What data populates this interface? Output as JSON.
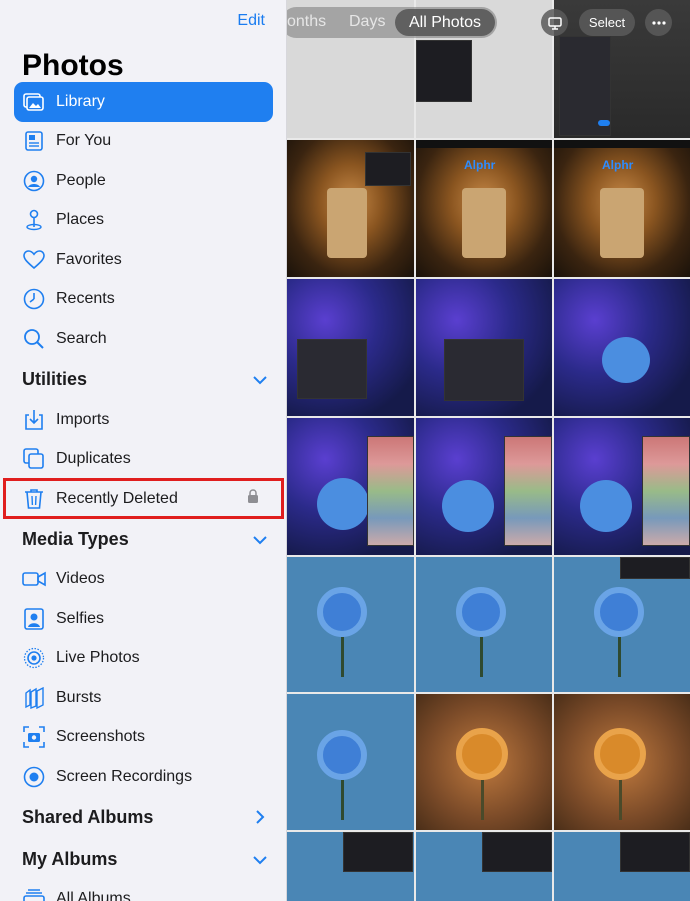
{
  "sidebar": {
    "edit_label": "Edit",
    "title": "Photos",
    "items": [
      {
        "label": "Library",
        "icon": "library-icon",
        "selected": true
      },
      {
        "label": "For You",
        "icon": "for-you-icon"
      },
      {
        "label": "People",
        "icon": "people-icon"
      },
      {
        "label": "Places",
        "icon": "places-icon"
      },
      {
        "label": "Favorites",
        "icon": "heart-icon"
      },
      {
        "label": "Recents",
        "icon": "clock-icon"
      },
      {
        "label": "Search",
        "icon": "search-icon"
      }
    ],
    "utilities": {
      "title": "Utilities",
      "items": [
        {
          "label": "Imports",
          "icon": "imports-icon"
        },
        {
          "label": "Duplicates",
          "icon": "duplicates-icon"
        },
        {
          "label": "Recently Deleted",
          "icon": "trash-icon",
          "locked": true,
          "highlighted": true
        }
      ]
    },
    "media_types": {
      "title": "Media Types",
      "items": [
        {
          "label": "Videos",
          "icon": "video-icon"
        },
        {
          "label": "Selfies",
          "icon": "selfie-icon"
        },
        {
          "label": "Live Photos",
          "icon": "live-photos-icon"
        },
        {
          "label": "Bursts",
          "icon": "bursts-icon"
        },
        {
          "label": "Screenshots",
          "icon": "screenshot-icon"
        },
        {
          "label": "Screen Recordings",
          "icon": "screen-recording-icon"
        }
      ]
    },
    "shared_albums": {
      "title": "Shared Albums"
    },
    "my_albums": {
      "title": "My Albums",
      "items": [
        {
          "label": "All Albums",
          "icon": "albums-icon"
        }
      ]
    }
  },
  "toolbar": {
    "tabs": [
      "onths",
      "Days",
      "All Photos"
    ],
    "active_tab": "All Photos",
    "select_label": "Select"
  },
  "colors": {
    "accent": "#1f7ff0",
    "highlight_border": "#e01e1e",
    "sidebar_bg": "#f2f2f7"
  }
}
